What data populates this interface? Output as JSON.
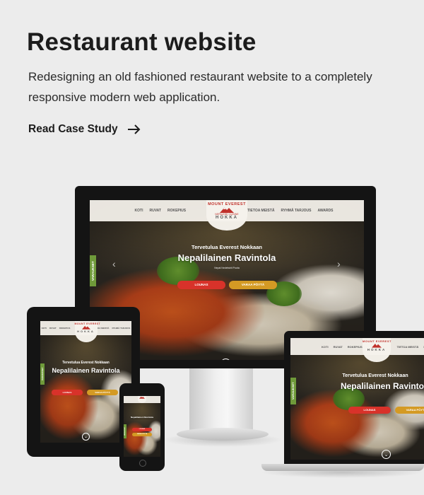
{
  "hero": {
    "title": "Restaurant website",
    "description": "Redesigning an old fashioned restaurant website to a completely responsive modern web application.",
    "cta_label": "Read Case Study",
    "cta_icon": "arrow-right-icon"
  },
  "website": {
    "nav": [
      "KOTI",
      "RUVAT",
      "ROKEPIUS",
      "TIETOA MEISTÄ",
      "RYHMÄ TARJOUS",
      "AWARDS"
    ],
    "logo_arc": "MOUNT EVEREST",
    "logo_sub": "NEPALESE CUISINE",
    "logo_brand": "HOKKA",
    "welcome": "Tervetulua Everest Nokkaan",
    "heading": "Nepalilainen Ravintola",
    "subcaption": "Nepal Nedelwhit Poota",
    "button_primary": "LOUNAS",
    "button_secondary": "VARAA PÖYTÄ",
    "side_tab": "VARAUKSET",
    "colors": {
      "red": "#d8322a",
      "gold": "#d49a24",
      "green": "#6f9a3a"
    }
  }
}
